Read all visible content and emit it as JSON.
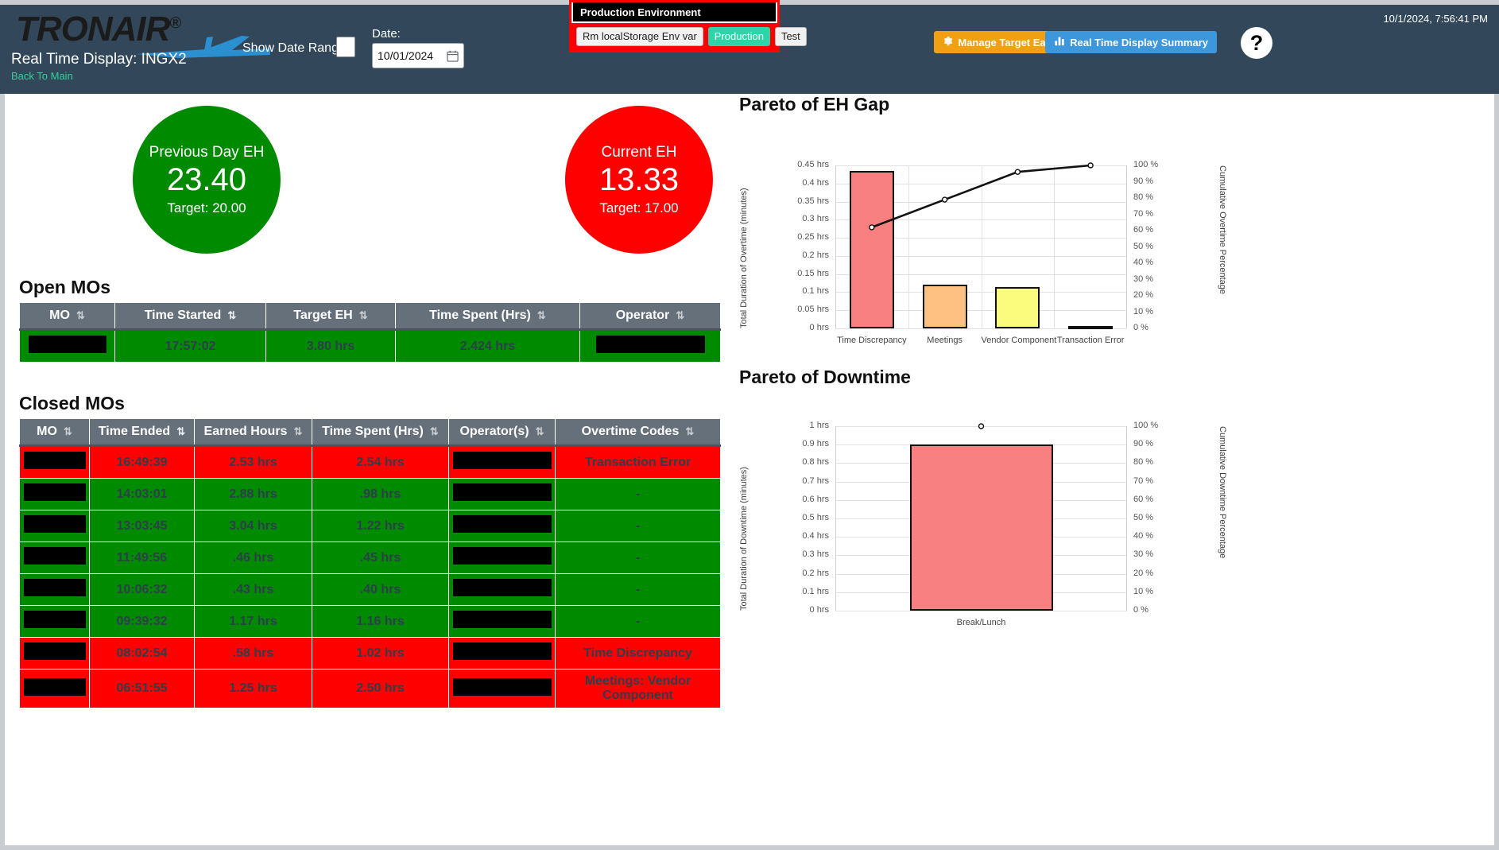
{
  "header": {
    "logo_text": "TRONAIR",
    "logo_reg": "®",
    "logo_icon": "airplane-icon",
    "page_title": "Real Time Display: INGX2",
    "back_link": "Back To Main",
    "show_date_range_label": "Show Date Range:",
    "date_label": "Date:",
    "date_value": "10/01/2024",
    "timestamp": "10/1/2024, 7:56:41 PM",
    "manage_button": "Manage Target Earned Hours",
    "summary_button": "Real Time Display Summary",
    "help_button": "?",
    "env": {
      "title": "Production Environment",
      "rm_button": "Rm localStorage Env var",
      "production_button": "Production",
      "test_button": "Test"
    }
  },
  "kpis": [
    {
      "name": "previous-day-eh",
      "label": "Previous Day EH",
      "value": "23.40",
      "target": "Target: 20.00",
      "color": "#008a00"
    },
    {
      "name": "current-eh",
      "label": "Current EH",
      "value": "13.33",
      "target": "Target: 17.00",
      "color": "#fe0000"
    }
  ],
  "open_mos": {
    "title": "Open MOs",
    "columns": [
      "MO",
      "Time Started",
      "Target EH",
      "Time Spent (Hrs)",
      "Operator"
    ],
    "sorted_column_index": 1,
    "rows": [
      {
        "status": "green",
        "mo": "",
        "time_started": "17:57:02",
        "target_eh": "3.80 hrs",
        "time_spent": "2.424 hrs",
        "operator": ""
      }
    ]
  },
  "closed_mos": {
    "title": "Closed MOs",
    "columns": [
      "MO",
      "Time Ended",
      "Earned Hours",
      "Time Spent (Hrs)",
      "Operator(s)",
      "Overtime Codes"
    ],
    "sorted_column_index": 1,
    "rows": [
      {
        "status": "red",
        "mo": "",
        "time_ended": "16:49:39",
        "earned_hours": "2.53 hrs",
        "time_spent": "2.54 hrs",
        "operators": "",
        "overtime_codes": "Transaction Error"
      },
      {
        "status": "green",
        "mo": "",
        "time_ended": "14:03:01",
        "earned_hours": "2.88 hrs",
        "time_spent": ".98 hrs",
        "operators": "",
        "overtime_codes": "-"
      },
      {
        "status": "green",
        "mo": "",
        "time_ended": "13:03:45",
        "earned_hours": "3.04 hrs",
        "time_spent": "1.22 hrs",
        "operators": "",
        "overtime_codes": "-"
      },
      {
        "status": "green",
        "mo": "",
        "time_ended": "11:49:56",
        "earned_hours": ".46 hrs",
        "time_spent": ".45 hrs",
        "operators": "",
        "overtime_codes": "-"
      },
      {
        "status": "green",
        "mo": "",
        "time_ended": "10:06:32",
        "earned_hours": ".43 hrs",
        "time_spent": ".40 hrs",
        "operators": "",
        "overtime_codes": "-"
      },
      {
        "status": "green",
        "mo": "",
        "time_ended": "09:39:32",
        "earned_hours": "1.17 hrs",
        "time_spent": "1.16 hrs",
        "operators": "",
        "overtime_codes": "-"
      },
      {
        "status": "red",
        "mo": "",
        "time_ended": "08:02:54",
        "earned_hours": ".58 hrs",
        "time_spent": "1.02 hrs",
        "operators": "",
        "overtime_codes": "Time Discrepancy"
      },
      {
        "status": "red",
        "mo": "",
        "time_ended": "06:51:55",
        "earned_hours": "1.25 hrs",
        "time_spent": "2.50 hrs",
        "operators": "",
        "overtime_codes": "Meetings: Vendor Component"
      }
    ]
  },
  "chart_data": [
    {
      "name": "pareto-eh-gap",
      "type": "bar",
      "title": "Pareto of EH Gap",
      "xlabel": "",
      "ylabel": "Total Duration of Overtime (minutes)",
      "y2label": "Cumulative Overtime Percentage",
      "categories": [
        "Time Discrepancy",
        "Meetings",
        "Vendor Component",
        "Transaction Error"
      ],
      "values": [
        0.435,
        0.12,
        0.115,
        0.005
      ],
      "bar_colors": [
        "#f98080",
        "#ffc182",
        "#fbfb7d",
        "#7fd4e0"
      ],
      "ylim": [
        0,
        0.45
      ],
      "yticks": [
        "0 hrs",
        "0.05 hrs",
        "0.1 hrs",
        "0.15 hrs",
        "0.2 hrs",
        "0.25 hrs",
        "0.3 hrs",
        "0.35 hrs",
        "0.4 hrs",
        "0.45 hrs"
      ],
      "y2lim": [
        0,
        100
      ],
      "y2ticks": [
        "0 %",
        "10 %",
        "20 %",
        "30 %",
        "40 %",
        "50 %",
        "60 %",
        "70 %",
        "80 %",
        "90 %",
        "100 %"
      ],
      "cumulative": [
        62,
        79,
        96,
        100
      ],
      "grid": true,
      "legend": "none"
    },
    {
      "name": "pareto-downtime",
      "type": "bar",
      "title": "Pareto of Downtime",
      "xlabel": "",
      "ylabel": "Total Duration of Downtime (minutes)",
      "y2label": "Cumulative Downtime Percentage",
      "categories": [
        "Break/Lunch"
      ],
      "values": [
        0.9
      ],
      "bar_colors": [
        "#f98080"
      ],
      "ylim": [
        0,
        1
      ],
      "yticks": [
        "0 hrs",
        "0.1 hrs",
        "0.2 hrs",
        "0.3 hrs",
        "0.4 hrs",
        "0.5 hrs",
        "0.6 hrs",
        "0.7 hrs",
        "0.8 hrs",
        "0.9 hrs",
        "1 hrs"
      ],
      "y2lim": [
        0,
        100
      ],
      "y2ticks": [
        "0 %",
        "10 %",
        "20 %",
        "30 %",
        "40 %",
        "50 %",
        "60 %",
        "70 %",
        "80 %",
        "90 %",
        "100 %"
      ],
      "cumulative": [
        100
      ],
      "grid": true,
      "legend": "none"
    }
  ]
}
